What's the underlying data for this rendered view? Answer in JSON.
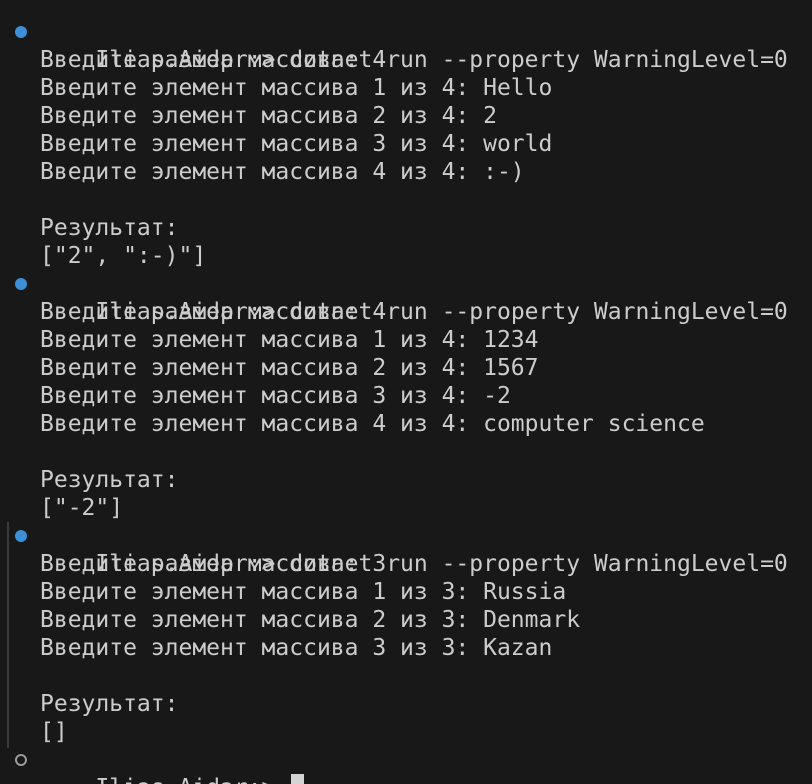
{
  "prompt": "Ilias.Aidar:>",
  "command": "dotnet run --property WarningLevel=0",
  "colors": {
    "background": "#181818",
    "text": "#cccccc",
    "success_marker": "#3d8fd6",
    "pending_marker": "#9a9a9a"
  },
  "runs": [
    {
      "output": [
        "Введите размер массива: 4",
        "Введите элемент массива 1 из 4: Hello",
        "Введите элемент массива 2 из 4: 2",
        "Введите элемент массива 3 из 4: world",
        "Введите элемент массива 4 из 4: :-)",
        "",
        "Результат:",
        "[\"2\", \":-)\"]"
      ]
    },
    {
      "output": [
        "Введите размер массива: 4",
        "Введите элемент массива 1 из 4: 1234",
        "Введите элемент массива 2 из 4: 1567",
        "Введите элемент массива 3 из 4: -2",
        "Введите элемент массива 4 из 4: computer science",
        "",
        "Результат:",
        "[\"-2\"]"
      ]
    },
    {
      "output": [
        "Введите размер массива: 3",
        "Введите элемент массива 1 из 3: Russia",
        "Введите элемент массива 2 из 3: Denmark",
        "Введите элемент массива 3 из 3: Kazan",
        "",
        "Результат:",
        "[]"
      ]
    }
  ]
}
